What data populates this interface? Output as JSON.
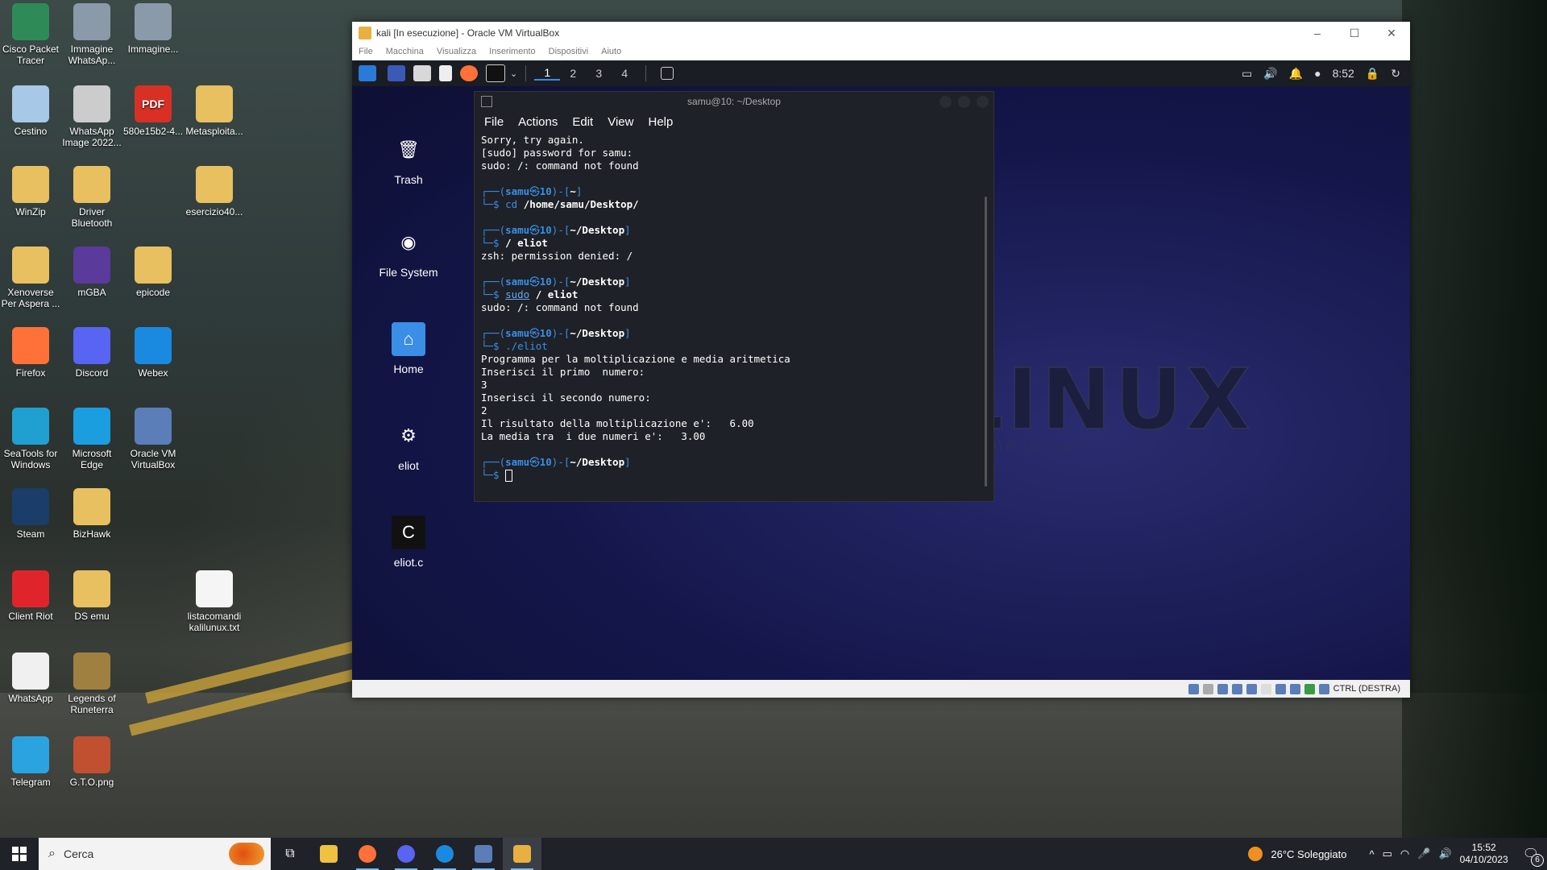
{
  "desktop": {
    "icons": [
      {
        "label": "Cisco Packet Tracer",
        "color": "#2e8b57"
      },
      {
        "label": "Immagine WhatsAp...",
        "color": "#8a9aa8"
      },
      {
        "label": "Immagine...",
        "color": "#8a9aa8"
      },
      {
        "label": "Cestino",
        "color": "#a8c8e8"
      },
      {
        "label": "WhatsApp Image 2022...",
        "color": "#ccc"
      },
      {
        "label": "580e15b2-4...",
        "color": "#d93025"
      },
      {
        "label": "Metasploita...",
        "color": "#e8c060"
      },
      {
        "label": "WinZip",
        "color": "#e8c060"
      },
      {
        "label": "Driver Bluetooth",
        "color": "#e8c060"
      },
      {
        "label": "esercizio40...",
        "color": "#e8c060"
      },
      {
        "label": "Xenoverse Per Aspera ...",
        "color": "#e8c060"
      },
      {
        "label": "mGBA",
        "color": "#5a3a9a"
      },
      {
        "label": "epicode",
        "color": "#e8c060"
      },
      {
        "label": "Firefox",
        "color": "#ff7139"
      },
      {
        "label": "Discord",
        "color": "#5865f2"
      },
      {
        "label": "Webex",
        "color": "#1a8ae0"
      },
      {
        "label": "SeaTools for Windows",
        "color": "#20a0d0"
      },
      {
        "label": "Microsoft Edge",
        "color": "#1a9ee0"
      },
      {
        "label": "Oracle VM VirtualBox",
        "color": "#5b7db8"
      },
      {
        "label": "Steam",
        "color": "#1a3d6a"
      },
      {
        "label": "BizHawk",
        "color": "#e8c060"
      },
      {
        "label": "Client Riot",
        "color": "#e0242c"
      },
      {
        "label": "DS emu",
        "color": "#e8c060"
      },
      {
        "label": "listacomandi kalilunux.txt",
        "color": "#f5f5f5"
      },
      {
        "label": "WhatsApp",
        "color": "#f0f0f0"
      },
      {
        "label": "Legends of Runeterra",
        "color": "#a08040"
      },
      {
        "label": "Telegram",
        "color": "#2aa3e0"
      },
      {
        "label": "G.T.O.png",
        "color": "#c05030"
      }
    ],
    "pdf_text": "PDF"
  },
  "vbox": {
    "title": "kali  [In esecuzione] - Oracle VM VirtualBox",
    "menu": [
      "File",
      "Macchina",
      "Visualizza",
      "Inserimento",
      "Dispositivi",
      "Aiuto"
    ],
    "window_controls": {
      "minimize": "–",
      "maximize": "☐",
      "close": "✕"
    },
    "status_text": "CTRL (DESTRA)"
  },
  "kali_panel": {
    "workspaces": [
      "1",
      "2",
      "3",
      "4"
    ],
    "time": "8:52"
  },
  "kali_desktop": {
    "icons": [
      {
        "label": "Trash",
        "glyph": "🗑"
      },
      {
        "label": "File System",
        "glyph": "◉"
      },
      {
        "label": "Home",
        "glyph": "⌂"
      },
      {
        "label": "eliot",
        "glyph": "⚙"
      },
      {
        "label": "eliot.c",
        "glyph": "C"
      }
    ],
    "logo": "KALI LINUX",
    "tagline": "\"the quieter you become, the more you are able to hear\""
  },
  "terminal": {
    "title": "samu@10: ~/Desktop",
    "menu": [
      "File",
      "Actions",
      "Edit",
      "View",
      "Help"
    ],
    "out1": "Sorry, try again.",
    "out2": "[sudo] password for samu:",
    "out3": "sudo: /: command not found",
    "p1_dir": "~",
    "c1_cmd": "cd",
    "c1_arg": "/home/samu/Desktop/",
    "p2_dir": "~/Desktop",
    "c2": "/ eliot",
    "out4": "zsh: permission denied: /",
    "p3_dir": "~/Desktop",
    "c3_sudo": "sudo",
    "c3_rest": "/ eliot",
    "out5": "sudo: /: command not found",
    "p4_dir": "~/Desktop",
    "c4": "./eliot",
    "prog1": "Programma per la moltiplicazione e media aritmetica",
    "prog2": "Inserisci il primo  numero:",
    "prog3": "3",
    "prog4": "Inserisci il secondo numero:",
    "prog5": "2",
    "prog6": "Il risultato della moltiplicazione e':   6.00",
    "prog7": "La media tra  i due numeri e':   3.00",
    "p5_dir": "~/Desktop",
    "user": "samu",
    "host": "10"
  },
  "taskbar": {
    "search_placeholder": "Cerca",
    "weather": "26°C  Soleggiato",
    "time": "15:52",
    "date": "04/10/2023",
    "notifications": "6"
  }
}
